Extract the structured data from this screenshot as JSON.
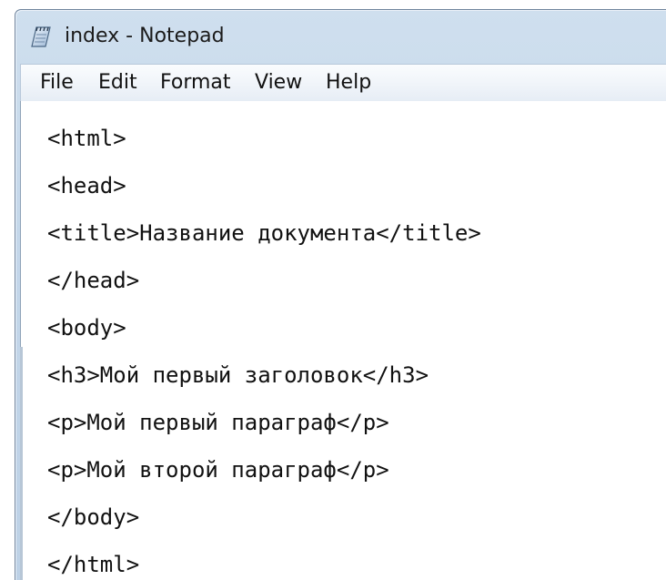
{
  "window": {
    "title": "index - Notepad"
  },
  "menu": {
    "items": [
      {
        "label": "File"
      },
      {
        "label": "Edit"
      },
      {
        "label": "Format"
      },
      {
        "label": "View"
      },
      {
        "label": "Help"
      }
    ]
  },
  "editor": {
    "lines": [
      "<html>",
      "<head>",
      "<title>Название документа</title>",
      "</head>",
      "<body>",
      "<h3>Мой первый заголовок</h3>",
      "<p>Мой первый параграф</p>",
      "<p>Мой второй параграф</p>",
      "</body>",
      "</html>"
    ]
  },
  "colors": {
    "titlebar": "#c9dbed",
    "menubar": "#f0f4f9",
    "text": "#111111"
  },
  "icons": {
    "app": "notepad-icon"
  }
}
